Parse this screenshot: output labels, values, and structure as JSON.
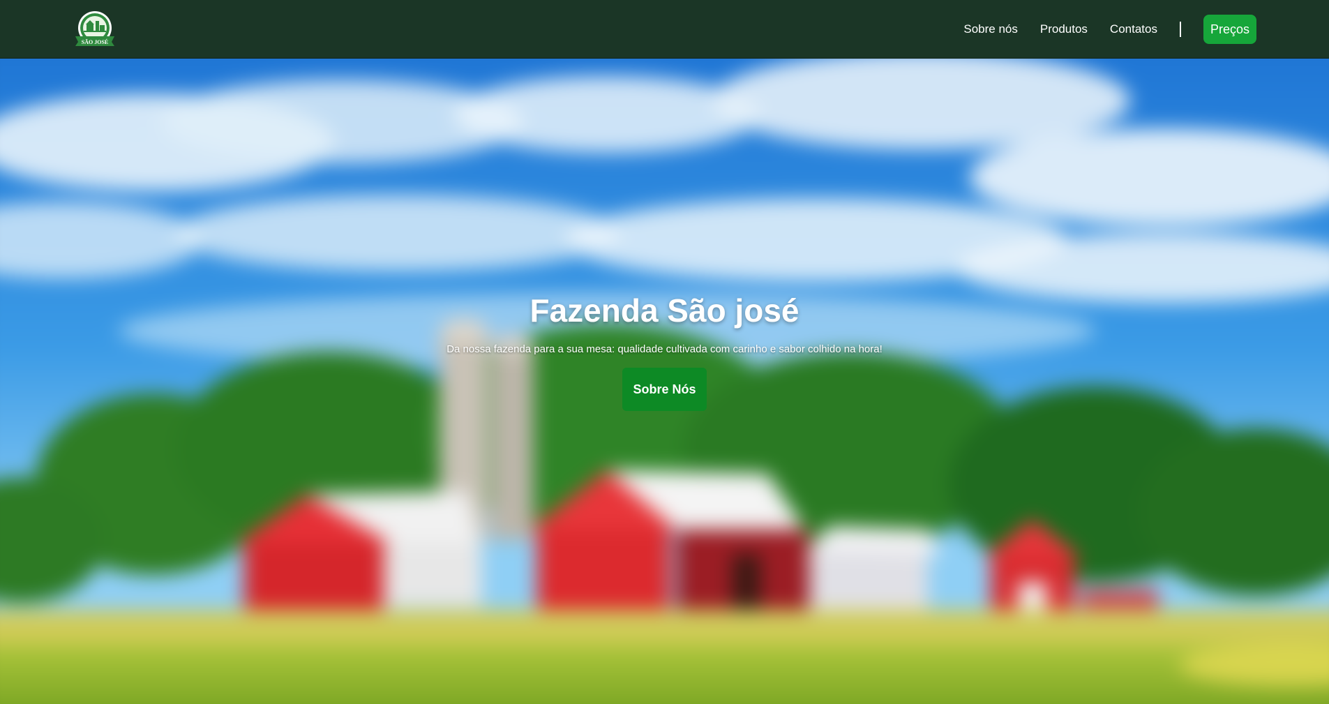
{
  "header": {
    "logo": {
      "text": "SÃO JOSÉ",
      "icon": "farm-logo-icon"
    },
    "nav": {
      "items": [
        {
          "label": "Sobre nós"
        },
        {
          "label": "Produtos"
        },
        {
          "label": "Contatos"
        }
      ],
      "price_button": "Preços"
    }
  },
  "hero": {
    "title": "Fazenda São josé",
    "subtitle": "Da nossa fazenda para a sua mesa: qualidade cultivada com carinho e sabor colhido na hora!",
    "button": "Sobre Nós"
  },
  "colors": {
    "header_bg": "#1b3626",
    "accent_green": "#16a63a",
    "hero_button": "#0d8a25"
  }
}
